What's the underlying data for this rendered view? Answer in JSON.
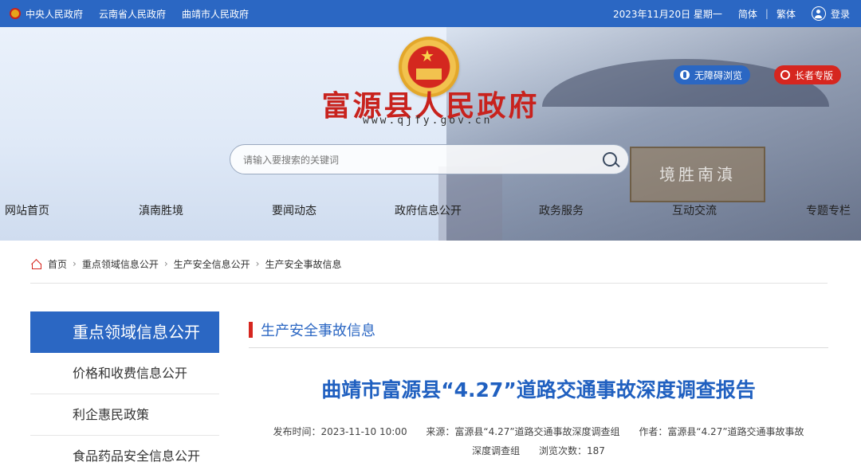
{
  "topbar": {
    "links": [
      "中央人民政府",
      "云南省人民政府",
      "曲靖市人民政府"
    ],
    "date": "2023年11月20日 星期一",
    "simplified": "简体",
    "divider": "|",
    "traditional": "繁体",
    "login": "登录"
  },
  "banner": {
    "title": "富源县人民政府",
    "url": "www.qjfy.gov.cn",
    "accessible_btn": "无障碍浏览",
    "elder_btn": "长者专版",
    "plaque_text": "境胜南滇"
  },
  "search": {
    "placeholder": "请输入要搜索的关键词"
  },
  "nav": {
    "items": [
      "网站首页",
      "滇南胜境",
      "要闻动态",
      "政府信息公开",
      "政务服务",
      "互动交流",
      "专题专栏"
    ]
  },
  "breadcrumb": {
    "items": [
      "首页",
      "重点领域信息公开",
      "生产安全信息公开",
      "生产安全事故信息"
    ]
  },
  "sidebar": {
    "header": "重点领域信息公开",
    "items": [
      "价格和收费信息公开",
      "利企惠民政策",
      "食品药品安全信息公开"
    ]
  },
  "section": {
    "title": "生产安全事故信息"
  },
  "article": {
    "title": "曲靖市富源县“4.27”道路交通事故深度调查报告",
    "publish_time": "发布时间：2023-11-10 10:00",
    "source": "来源：富源县“4.27”道路交通事故深度调查组",
    "author_line1": "作者：富源县“4.27”道路交通事故事故",
    "author_line2": "深度调查组",
    "views": "浏览次数：187"
  },
  "colors": {
    "primary": "#2b67c3",
    "accent_red": "#d6261f",
    "title_red": "#c8221d"
  }
}
